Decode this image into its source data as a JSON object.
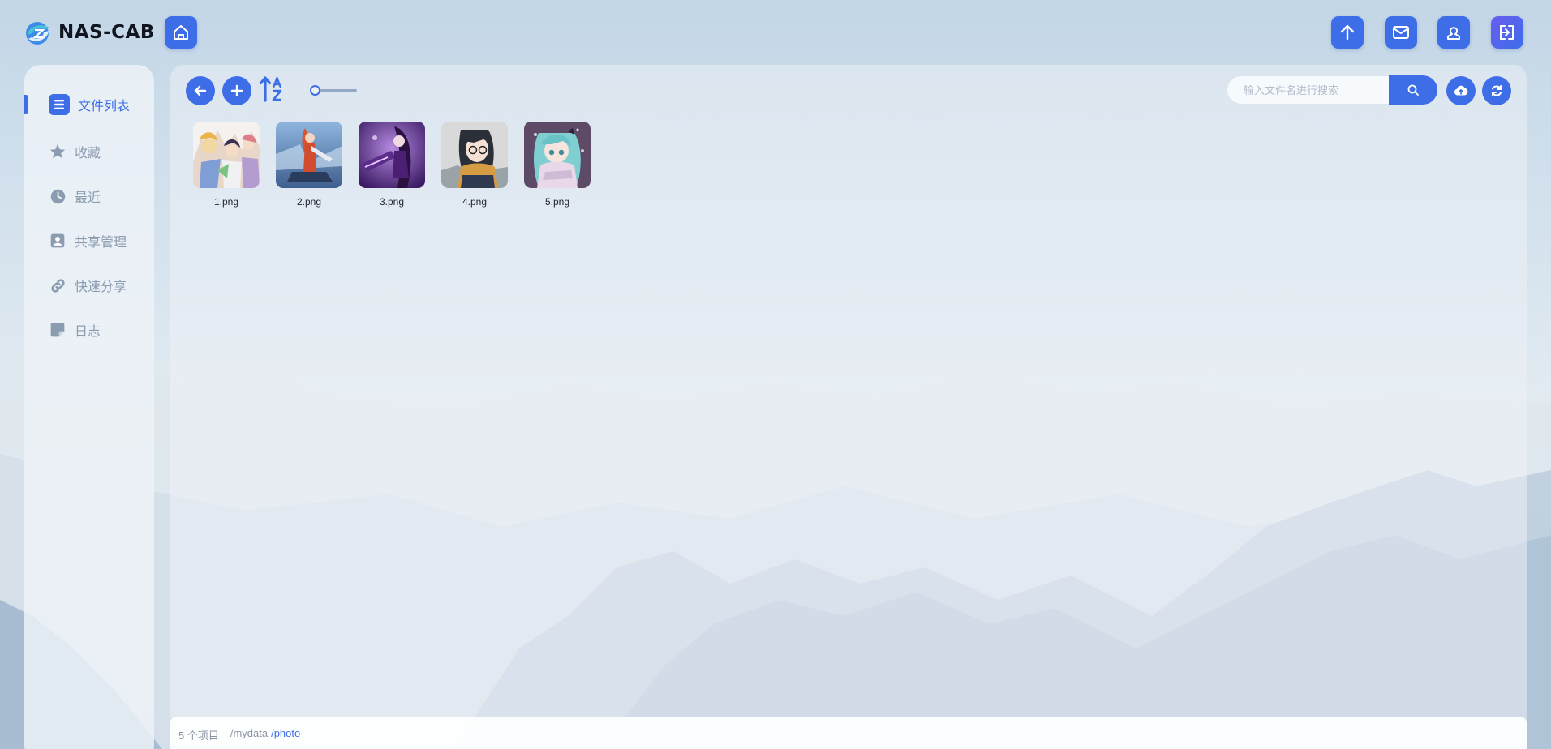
{
  "app": {
    "name": "NAS-CAB"
  },
  "topbar": {
    "home_icon": "home-icon",
    "upload_icon": "arrow-up-icon",
    "mail_icon": "mail-icon",
    "user_icon": "user-icon",
    "logout_icon": "logout-icon"
  },
  "sidebar": {
    "items": [
      {
        "label": "文件列表",
        "icon": "file-list-icon",
        "active": true
      },
      {
        "label": "收藏",
        "icon": "star-icon",
        "active": false
      },
      {
        "label": "最近",
        "icon": "clock-icon",
        "active": false
      },
      {
        "label": "共享管理",
        "icon": "share-manage-icon",
        "active": false
      },
      {
        "label": "快速分享",
        "icon": "link-icon",
        "active": false
      },
      {
        "label": "日志",
        "icon": "note-icon",
        "active": false
      }
    ]
  },
  "toolbar": {
    "search": {
      "placeholder": "输入文件名进行搜索",
      "value": ""
    },
    "zoom_level": 0.05
  },
  "files": [
    {
      "name": "1.png"
    },
    {
      "name": "2.png"
    },
    {
      "name": "3.png"
    },
    {
      "name": "4.png"
    },
    {
      "name": "5.png"
    }
  ],
  "status": {
    "count": "5 个项目",
    "path_root": "/mydata",
    "path_current": "/photo"
  },
  "colors": {
    "accent": "#3d6ee8",
    "muted_text": "#8b9bb0"
  }
}
